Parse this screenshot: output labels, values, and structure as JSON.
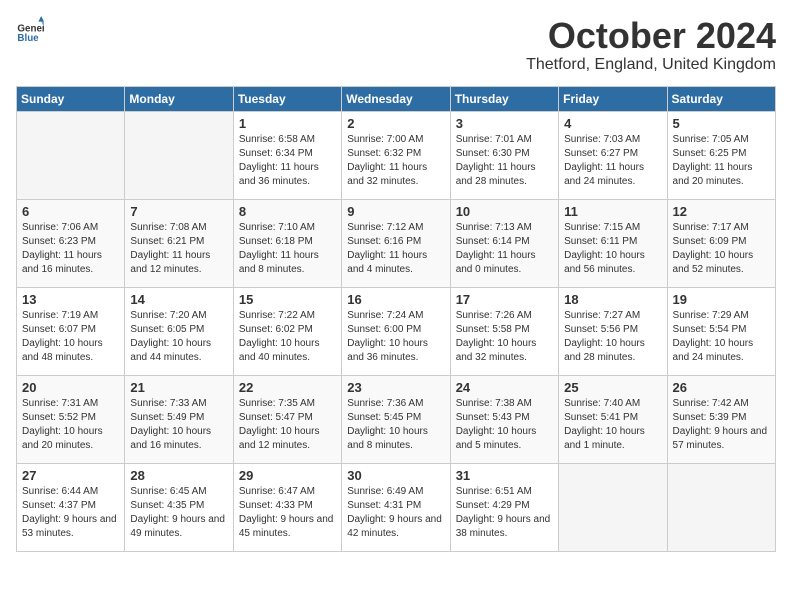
{
  "logo": {
    "general": "General",
    "blue": "Blue"
  },
  "title": "October 2024",
  "location": "Thetford, England, United Kingdom",
  "days_of_week": [
    "Sunday",
    "Monday",
    "Tuesday",
    "Wednesday",
    "Thursday",
    "Friday",
    "Saturday"
  ],
  "weeks": [
    [
      {
        "day": "",
        "info": ""
      },
      {
        "day": "",
        "info": ""
      },
      {
        "day": "1",
        "info": "Sunrise: 6:58 AM\nSunset: 6:34 PM\nDaylight: 11 hours and 36 minutes."
      },
      {
        "day": "2",
        "info": "Sunrise: 7:00 AM\nSunset: 6:32 PM\nDaylight: 11 hours and 32 minutes."
      },
      {
        "day": "3",
        "info": "Sunrise: 7:01 AM\nSunset: 6:30 PM\nDaylight: 11 hours and 28 minutes."
      },
      {
        "day": "4",
        "info": "Sunrise: 7:03 AM\nSunset: 6:27 PM\nDaylight: 11 hours and 24 minutes."
      },
      {
        "day": "5",
        "info": "Sunrise: 7:05 AM\nSunset: 6:25 PM\nDaylight: 11 hours and 20 minutes."
      }
    ],
    [
      {
        "day": "6",
        "info": "Sunrise: 7:06 AM\nSunset: 6:23 PM\nDaylight: 11 hours and 16 minutes."
      },
      {
        "day": "7",
        "info": "Sunrise: 7:08 AM\nSunset: 6:21 PM\nDaylight: 11 hours and 12 minutes."
      },
      {
        "day": "8",
        "info": "Sunrise: 7:10 AM\nSunset: 6:18 PM\nDaylight: 11 hours and 8 minutes."
      },
      {
        "day": "9",
        "info": "Sunrise: 7:12 AM\nSunset: 6:16 PM\nDaylight: 11 hours and 4 minutes."
      },
      {
        "day": "10",
        "info": "Sunrise: 7:13 AM\nSunset: 6:14 PM\nDaylight: 11 hours and 0 minutes."
      },
      {
        "day": "11",
        "info": "Sunrise: 7:15 AM\nSunset: 6:11 PM\nDaylight: 10 hours and 56 minutes."
      },
      {
        "day": "12",
        "info": "Sunrise: 7:17 AM\nSunset: 6:09 PM\nDaylight: 10 hours and 52 minutes."
      }
    ],
    [
      {
        "day": "13",
        "info": "Sunrise: 7:19 AM\nSunset: 6:07 PM\nDaylight: 10 hours and 48 minutes."
      },
      {
        "day": "14",
        "info": "Sunrise: 7:20 AM\nSunset: 6:05 PM\nDaylight: 10 hours and 44 minutes."
      },
      {
        "day": "15",
        "info": "Sunrise: 7:22 AM\nSunset: 6:02 PM\nDaylight: 10 hours and 40 minutes."
      },
      {
        "day": "16",
        "info": "Sunrise: 7:24 AM\nSunset: 6:00 PM\nDaylight: 10 hours and 36 minutes."
      },
      {
        "day": "17",
        "info": "Sunrise: 7:26 AM\nSunset: 5:58 PM\nDaylight: 10 hours and 32 minutes."
      },
      {
        "day": "18",
        "info": "Sunrise: 7:27 AM\nSunset: 5:56 PM\nDaylight: 10 hours and 28 minutes."
      },
      {
        "day": "19",
        "info": "Sunrise: 7:29 AM\nSunset: 5:54 PM\nDaylight: 10 hours and 24 minutes."
      }
    ],
    [
      {
        "day": "20",
        "info": "Sunrise: 7:31 AM\nSunset: 5:52 PM\nDaylight: 10 hours and 20 minutes."
      },
      {
        "day": "21",
        "info": "Sunrise: 7:33 AM\nSunset: 5:49 PM\nDaylight: 10 hours and 16 minutes."
      },
      {
        "day": "22",
        "info": "Sunrise: 7:35 AM\nSunset: 5:47 PM\nDaylight: 10 hours and 12 minutes."
      },
      {
        "day": "23",
        "info": "Sunrise: 7:36 AM\nSunset: 5:45 PM\nDaylight: 10 hours and 8 minutes."
      },
      {
        "day": "24",
        "info": "Sunrise: 7:38 AM\nSunset: 5:43 PM\nDaylight: 10 hours and 5 minutes."
      },
      {
        "day": "25",
        "info": "Sunrise: 7:40 AM\nSunset: 5:41 PM\nDaylight: 10 hours and 1 minute."
      },
      {
        "day": "26",
        "info": "Sunrise: 7:42 AM\nSunset: 5:39 PM\nDaylight: 9 hours and 57 minutes."
      }
    ],
    [
      {
        "day": "27",
        "info": "Sunrise: 6:44 AM\nSunset: 4:37 PM\nDaylight: 9 hours and 53 minutes."
      },
      {
        "day": "28",
        "info": "Sunrise: 6:45 AM\nSunset: 4:35 PM\nDaylight: 9 hours and 49 minutes."
      },
      {
        "day": "29",
        "info": "Sunrise: 6:47 AM\nSunset: 4:33 PM\nDaylight: 9 hours and 45 minutes."
      },
      {
        "day": "30",
        "info": "Sunrise: 6:49 AM\nSunset: 4:31 PM\nDaylight: 9 hours and 42 minutes."
      },
      {
        "day": "31",
        "info": "Sunrise: 6:51 AM\nSunset: 4:29 PM\nDaylight: 9 hours and 38 minutes."
      },
      {
        "day": "",
        "info": ""
      },
      {
        "day": "",
        "info": ""
      }
    ]
  ]
}
